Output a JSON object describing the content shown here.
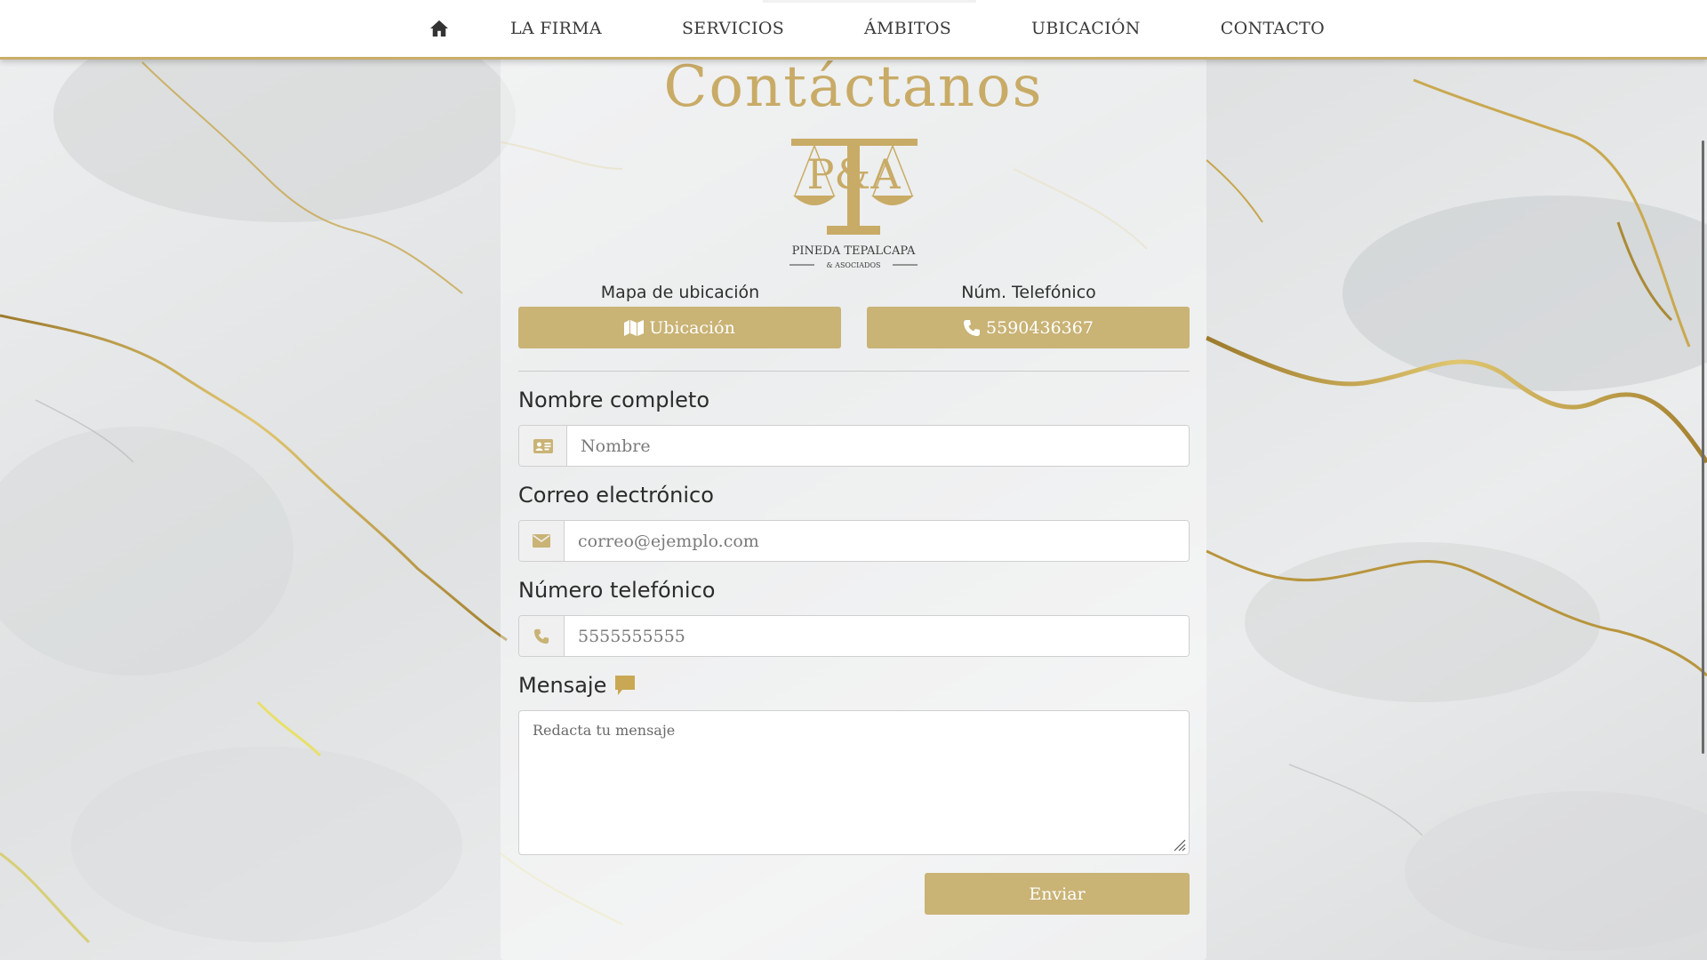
{
  "nav": {
    "items": [
      "LA FIRMA",
      "SERVICIOS",
      "ÁMBITOS",
      "UBICACIÓN",
      "CONTACTO"
    ]
  },
  "title": "Contáctanos",
  "logo": {
    "monogram": "P&A",
    "name": "PINEDA TEPALCAPA",
    "sub": "& ASOCIADOS"
  },
  "contact_info": {
    "map_label": "Mapa de ubicación",
    "map_button": "Ubicación",
    "phone_label": "Núm. Telefónico",
    "phone_button": "5590436367"
  },
  "form": {
    "name_label": "Nombre completo",
    "name_placeholder": "Nombre",
    "email_label": "Correo electrónico",
    "email_placeholder": "correo@ejemplo.com",
    "phone_label": "Número telefónico",
    "phone_placeholder": "5555555555",
    "message_label": "Mensaje",
    "message_placeholder": "Redacta tu mensaje",
    "submit": "Enviar"
  },
  "icons": {
    "home": "home-icon",
    "map": "map-icon",
    "phone": "phone-icon",
    "id_card": "id-card-icon",
    "envelope": "envelope-icon",
    "comment": "comment-icon"
  },
  "colors": {
    "gold": "#c9b375",
    "title_gold": "#c8ab66",
    "nav_border": "#c9ae68",
    "white": "#ffffff"
  }
}
